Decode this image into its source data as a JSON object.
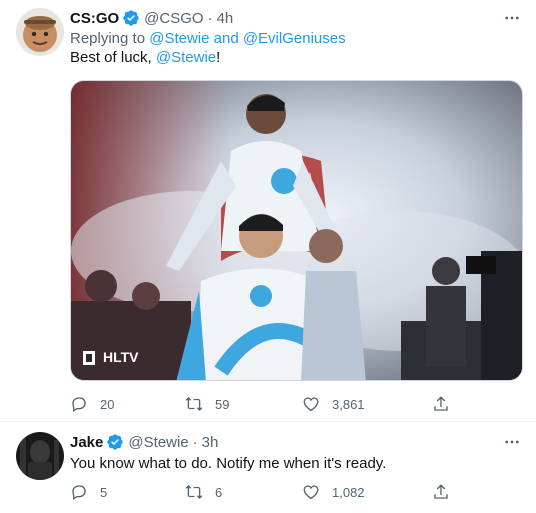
{
  "tweets": [
    {
      "author_name": "CS:GO",
      "author_handle": "@CSGO",
      "separator": "·",
      "time": "4h",
      "replying_prefix": "Replying to",
      "replying_to": "@Stewie and @EvilGeniuses",
      "text_prefix": "Best of luck, ",
      "text_mention": "@Stewie",
      "text_suffix": "!",
      "media_watermark": "HLTV",
      "reply_count": "20",
      "retweet_count": "59",
      "like_count": "3,861"
    },
    {
      "author_name": "Jake",
      "author_handle": "@Stewie",
      "separator": "·",
      "time": "3h",
      "text": "You know what to do. Notify me when it's ready.",
      "reply_count": "5",
      "retweet_count": "6",
      "like_count": "1,082"
    }
  ],
  "colors": {
    "accent": "#1d9bf0",
    "secondary_text": "#536471",
    "primary_text": "#0f1419"
  },
  "icons": [
    "verified-badge-icon",
    "more-icon",
    "reply-icon",
    "retweet-icon",
    "like-icon",
    "share-icon"
  ]
}
